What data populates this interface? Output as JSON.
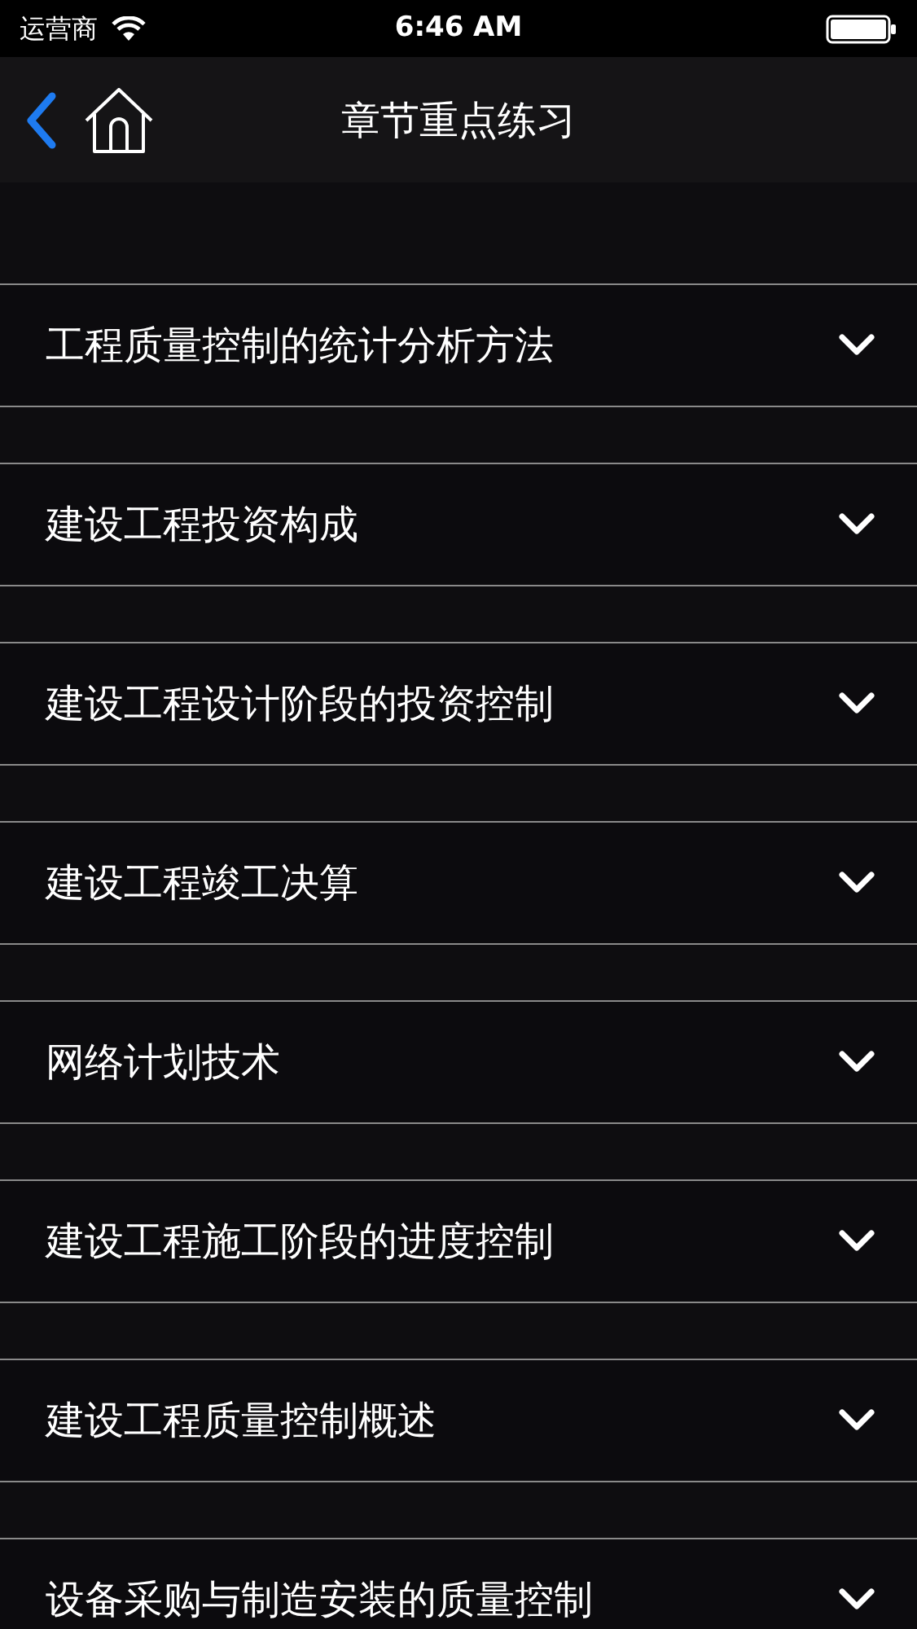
{
  "status_bar": {
    "carrier": "运营商",
    "time": "6:46 AM"
  },
  "nav_bar": {
    "title": "章节重点练习"
  },
  "chapters": [
    {
      "title": "工程质量控制的统计分析方法",
      "expanded": false
    },
    {
      "title": "建设工程投资构成",
      "expanded": false
    },
    {
      "title": "建设工程设计阶段的投资控制",
      "expanded": false
    },
    {
      "title": "建设工程竣工决算",
      "expanded": false
    },
    {
      "title": "网络计划技术",
      "expanded": false
    },
    {
      "title": "建设工程施工阶段的进度控制",
      "expanded": false
    },
    {
      "title": "建设工程质量控制概述",
      "expanded": false
    },
    {
      "title": "设备采购与制造安装的质量控制",
      "expanded": false
    }
  ]
}
